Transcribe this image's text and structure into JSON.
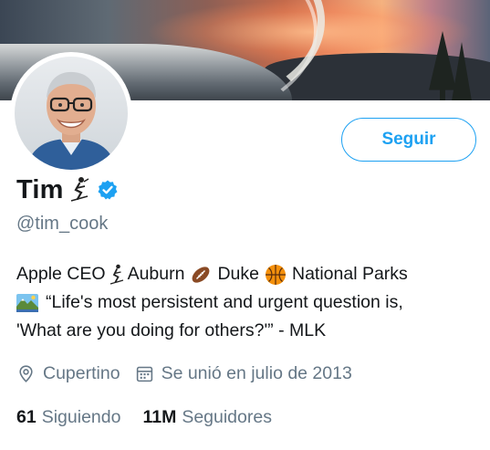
{
  "profile": {
    "display_name": "Tim",
    "name_glyph": "⛷",
    "handle": "@tim_cook",
    "bio_line1_a": "Apple CEO",
    "bio_line1_b": "Auburn",
    "bio_line1_c": "Duke",
    "bio_line1_d": "National Parks",
    "bio_line2": "“Life's most persistent and urgent question is,",
    "bio_line3": "'What are you doing for others?'” - MLK",
    "location": "Cupertino",
    "joined": "Se unió en julio de 2013",
    "following_count": "61",
    "following_label": "Siguiendo",
    "followers_count": "11M",
    "followers_label": "Seguidores"
  },
  "actions": {
    "follow_label": "Seguir"
  },
  "icons": {
    "verified": "verified-badge-icon",
    "location": "location-pin-icon",
    "calendar": "calendar-icon",
    "skier": "skier-emoji-icon",
    "football": "football-emoji-icon",
    "basketball": "basketball-emoji-icon",
    "national_park": "national-park-emoji-icon"
  },
  "colors": {
    "accent": "#1da1f2",
    "text": "#14171a",
    "secondary_text": "#657786"
  }
}
